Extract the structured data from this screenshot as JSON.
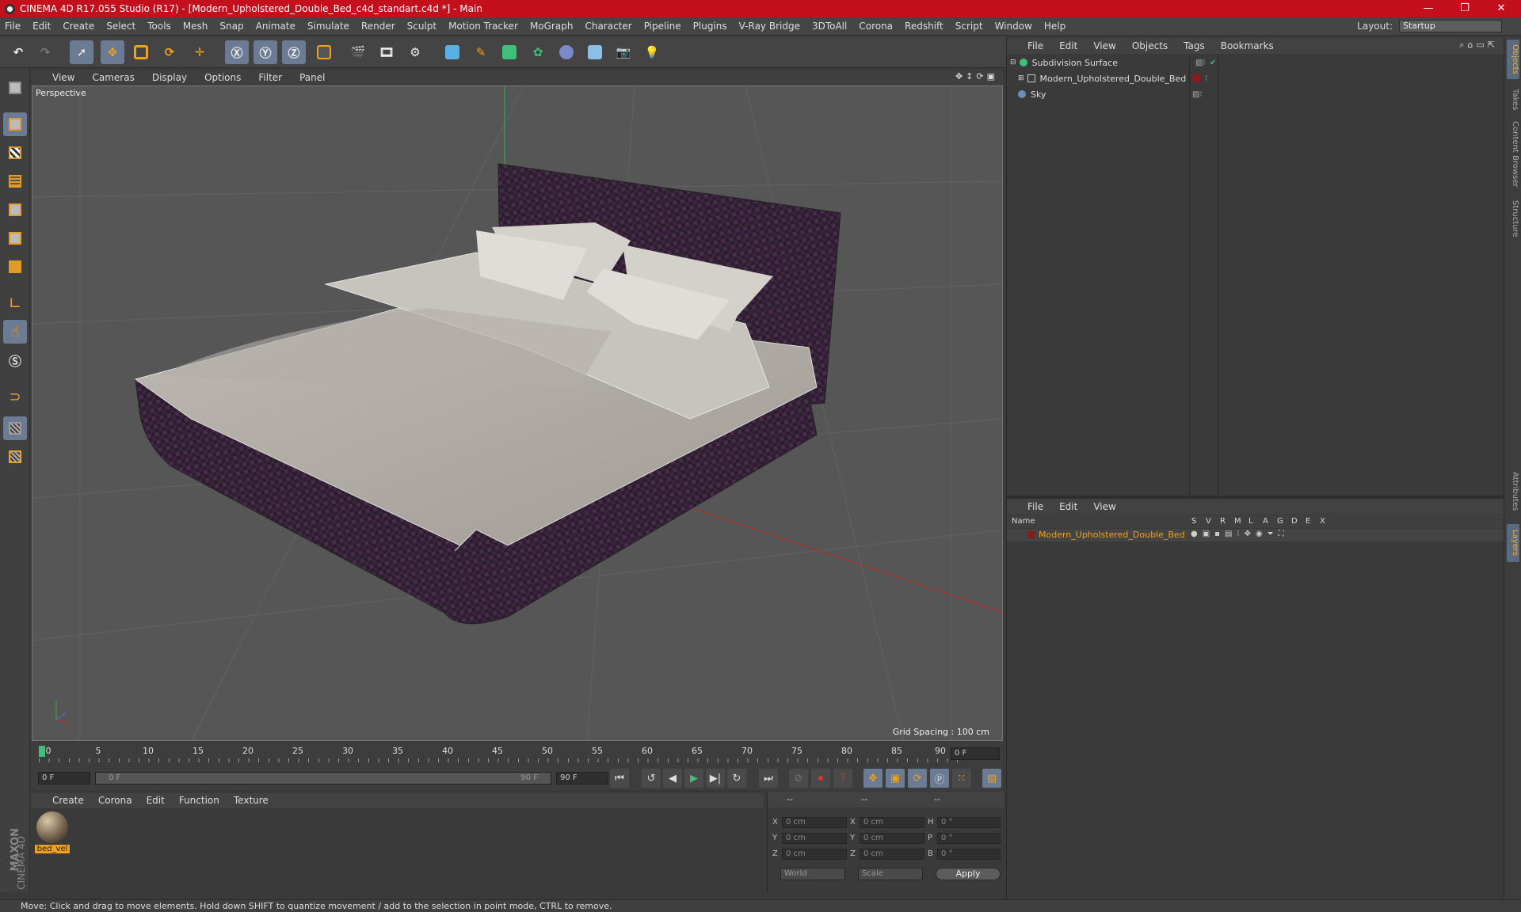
{
  "window": {
    "title": "CINEMA 4D R17.055 Studio (R17) - [Modern_Upholstered_Double_Bed_c4d_standart.c4d *] - Main",
    "minimize": "—",
    "restore": "❐",
    "close": "✕"
  },
  "menu": [
    "File",
    "Edit",
    "Create",
    "Select",
    "Tools",
    "Mesh",
    "Snap",
    "Animate",
    "Simulate",
    "Render",
    "Sculpt",
    "Motion Tracker",
    "MoGraph",
    "Character",
    "Pipeline",
    "Plugins",
    "V-Ray Bridge",
    "3DToAll",
    "Corona",
    "Redshift",
    "Script",
    "Window",
    "Help"
  ],
  "layout": {
    "label": "Layout:",
    "value": "Startup"
  },
  "viewport": {
    "menu": [
      "View",
      "Cameras",
      "Display",
      "Options",
      "Filter",
      "Panel"
    ],
    "label": "Perspective",
    "grid_spacing": "Grid Spacing : 100 cm"
  },
  "timeline": {
    "ticks": [
      "0",
      "5",
      "10",
      "15",
      "20",
      "25",
      "30",
      "35",
      "40",
      "45",
      "50",
      "55",
      "60",
      "65",
      "70",
      "75",
      "80",
      "85",
      "90"
    ],
    "current_frame": "0 F",
    "start": "0 F",
    "range_start": "0 F",
    "range_end": "90 F",
    "end": "90 F"
  },
  "materials": {
    "menu": [
      "Create",
      "Corona",
      "Edit",
      "Function",
      "Texture"
    ],
    "items": [
      {
        "name": "bed_vel"
      }
    ]
  },
  "coords": {
    "header": [
      "--",
      "--",
      "--"
    ],
    "rows": [
      {
        "a": "X",
        "av": "0 cm",
        "b": "X",
        "bv": "0 cm",
        "c": "H",
        "cv": "0 °"
      },
      {
        "a": "Y",
        "av": "0 cm",
        "b": "Y",
        "bv": "0 cm",
        "c": "P",
        "cv": "0 °"
      },
      {
        "a": "Z",
        "av": "0 cm",
        "b": "Z",
        "bv": "0 cm",
        "c": "B",
        "cv": "0 °"
      }
    ],
    "mode": "World",
    "scale": "Scale",
    "apply": "Apply"
  },
  "objects_panel": {
    "menu": [
      "File",
      "Edit",
      "View",
      "Objects",
      "Tags",
      "Bookmarks"
    ],
    "items": [
      {
        "name": "Subdivision Surface",
        "color": "#7fc97f"
      },
      {
        "name": "Modern_Upholstered_Double_Bed",
        "color": "#8b1a1a"
      },
      {
        "name": "Sky",
        "color": "#6a8fbf"
      }
    ]
  },
  "layers_panel": {
    "menu": [
      "File",
      "Edit",
      "View"
    ],
    "columns": [
      "Name",
      "S",
      "V",
      "R",
      "M",
      "L",
      "A",
      "G",
      "D",
      "E",
      "X"
    ],
    "items": [
      {
        "name": "Modern_Upholstered_Double_Bed",
        "color": "#8b1a1a"
      }
    ]
  },
  "side_tabs": [
    "Objects",
    "Takes",
    "Content Browser",
    "Structure",
    "Attributes",
    "Layers"
  ],
  "status": "Move: Click and drag to move elements. Hold down SHIFT to quantize movement / add to the selection in point mode, CTRL to remove.",
  "brand": {
    "maxon": "MAXON",
    "product": "CINEMA 4D"
  },
  "colors": {
    "title_bar": "#c4101d",
    "accent_orange": "#f0a020",
    "selected_tool": "#6a7b93"
  }
}
